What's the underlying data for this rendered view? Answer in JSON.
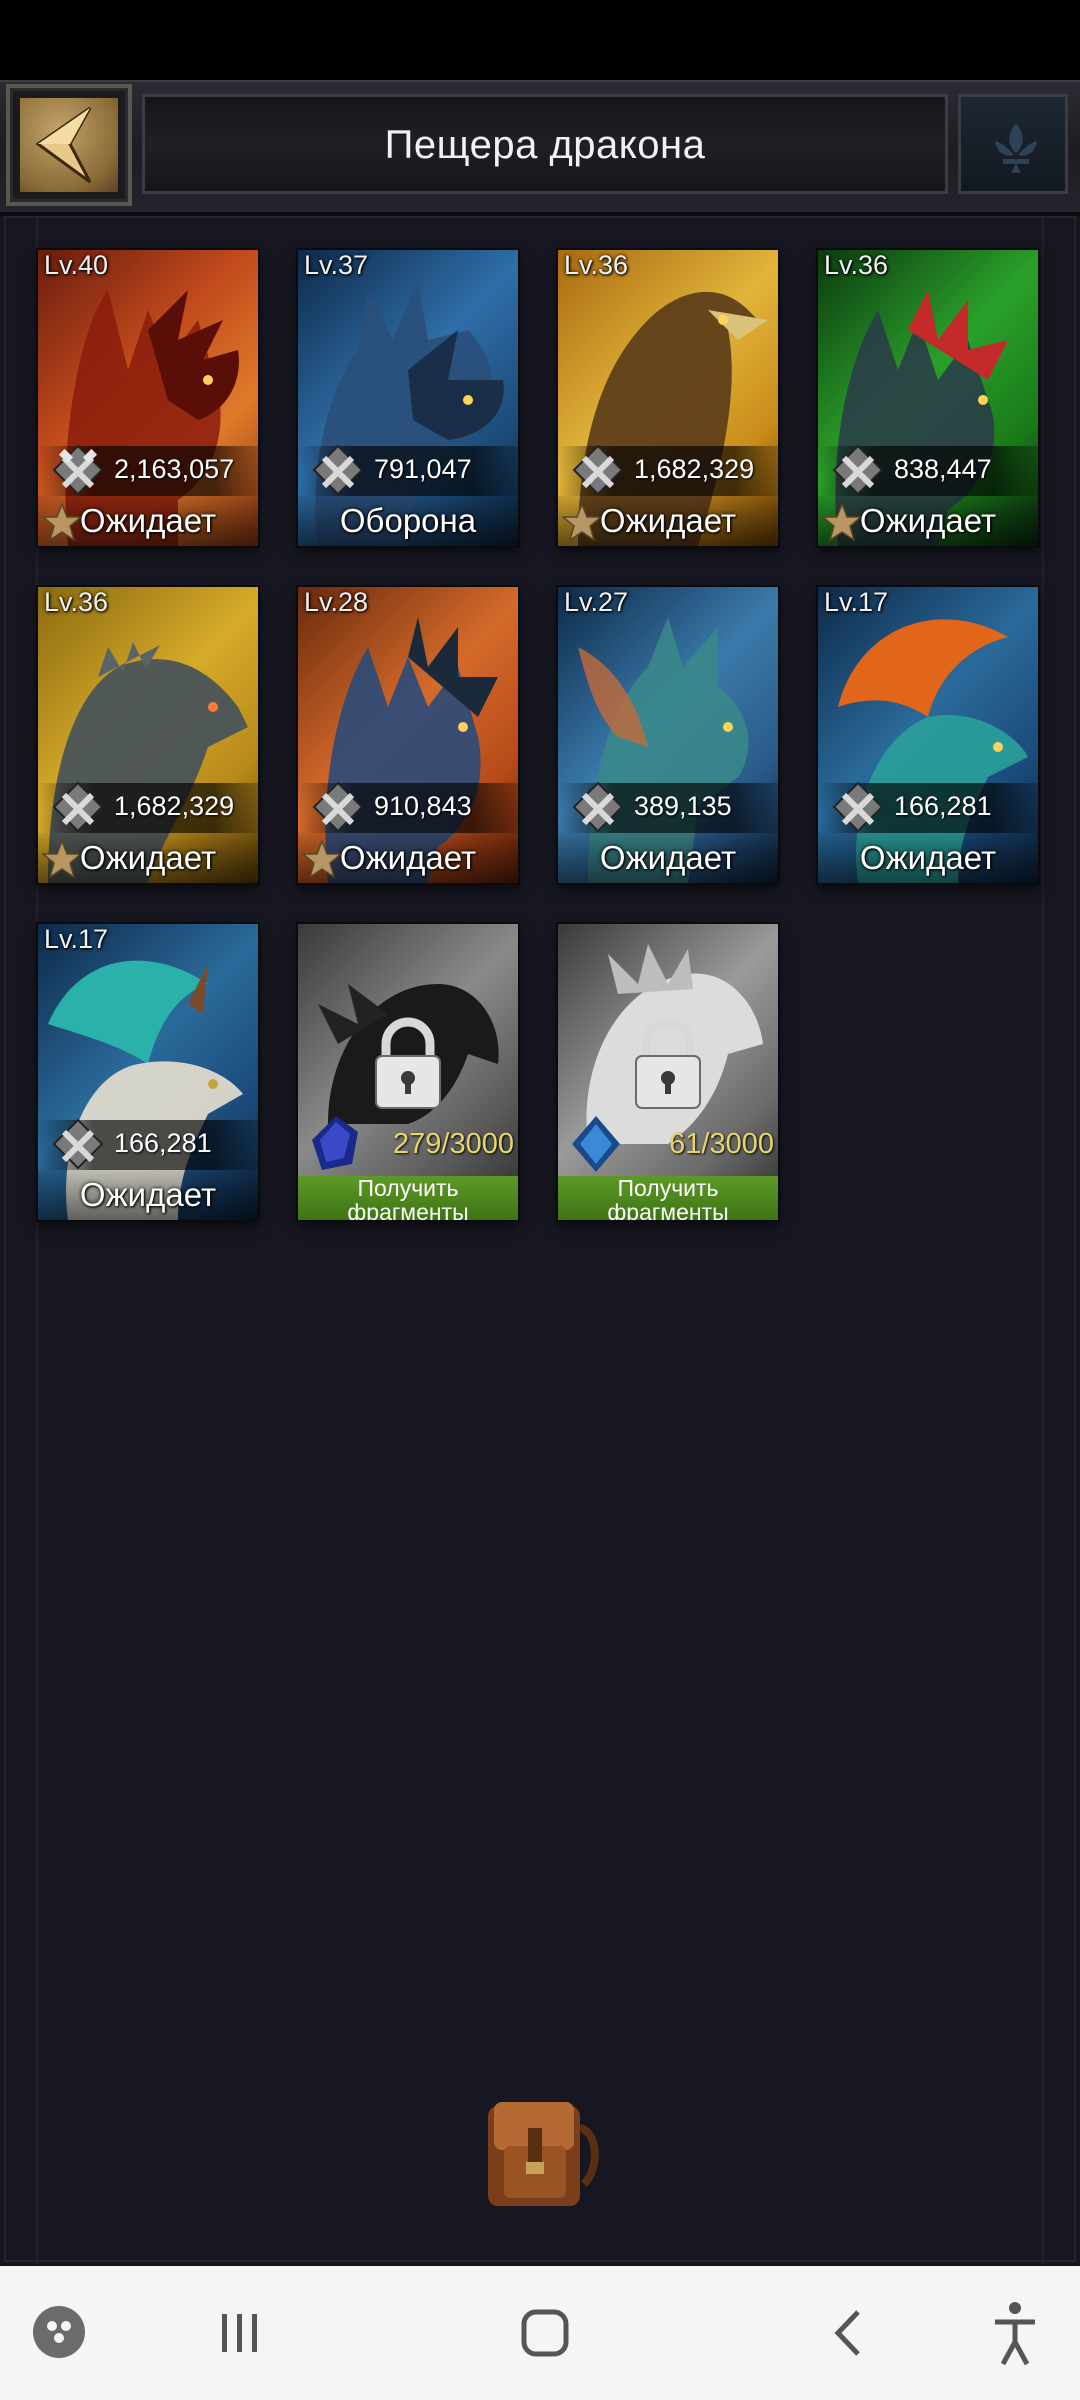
{
  "header": {
    "title": "Пещера дракона"
  },
  "dragons": [
    {
      "level": "Lv.40",
      "power": "2,163,057",
      "status": "Ожидает",
      "starred": true
    },
    {
      "level": "Lv.37",
      "power": "791,047",
      "status": "Оборона",
      "starred": false
    },
    {
      "level": "Lv.36",
      "power": "1,682,329",
      "status": "Ожидает",
      "starred": true
    },
    {
      "level": "Lv.36",
      "power": "838,447",
      "status": "Ожидает",
      "starred": true
    },
    {
      "level": "Lv.36",
      "power": "1,682,329",
      "status": "Ожидает",
      "starred": true
    },
    {
      "level": "Lv.28",
      "power": "910,843",
      "status": "Ожидает",
      "starred": true
    },
    {
      "level": "Lv.27",
      "power": "389,135",
      "status": "Ожидает",
      "starred": false
    },
    {
      "level": "Lv.17",
      "power": "166,281",
      "status": "Ожидает",
      "starred": false
    },
    {
      "level": "Lv.17",
      "power": "166,281",
      "status": "Ожидает",
      "starred": false
    }
  ],
  "locked_dragons": [
    {
      "fragments": "279/3000",
      "button_line1": "Получить",
      "button_line2": "фрагменты"
    },
    {
      "fragments": "61/3000",
      "button_line1": "Получить",
      "button_line2": "фрагменты"
    }
  ],
  "colors": {
    "background": "#16171e",
    "fragment_text": "#e8d56a",
    "button_green": "#4f8a1e"
  },
  "icons": {
    "back": "back-arrow-icon",
    "power": "crossed-hammers-icon",
    "star": "star-icon",
    "lock": "padlock-icon",
    "backpack": "backpack-icon"
  }
}
